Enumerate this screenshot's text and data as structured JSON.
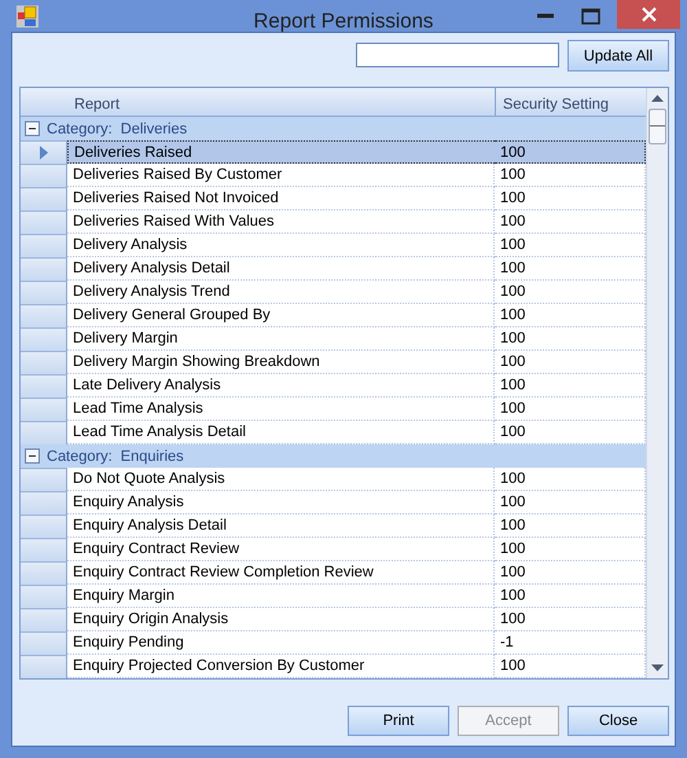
{
  "window": {
    "title": "Report Permissions"
  },
  "update_button": {
    "label": "Update All"
  },
  "table": {
    "columns": [
      "Report",
      "Security Setting"
    ],
    "groups": [
      {
        "label": "Category:  Deliveries",
        "expanded": true,
        "rows": [
          {
            "report": "Deliveries Raised",
            "setting": "100",
            "selected": true
          },
          {
            "report": "Deliveries Raised By Customer",
            "setting": "100",
            "selected": false
          },
          {
            "report": "Deliveries Raised Not Invoiced",
            "setting": "100",
            "selected": false
          },
          {
            "report": "Deliveries Raised With Values",
            "setting": "100",
            "selected": false
          },
          {
            "report": "Delivery Analysis",
            "setting": "100",
            "selected": false
          },
          {
            "report": "Delivery Analysis Detail",
            "setting": "100",
            "selected": false
          },
          {
            "report": "Delivery Analysis Trend",
            "setting": "100",
            "selected": false
          },
          {
            "report": "Delivery General Grouped By",
            "setting": "100",
            "selected": false
          },
          {
            "report": "Delivery Margin",
            "setting": "100",
            "selected": false
          },
          {
            "report": "Delivery Margin Showing Breakdown",
            "setting": "100",
            "selected": false
          },
          {
            "report": "Late Delivery Analysis",
            "setting": "100",
            "selected": false
          },
          {
            "report": "Lead Time Analysis",
            "setting": "100",
            "selected": false
          },
          {
            "report": "Lead Time Analysis Detail",
            "setting": "100",
            "selected": false
          }
        ]
      },
      {
        "label": "Category:  Enquiries",
        "expanded": true,
        "rows": [
          {
            "report": "Do Not Quote Analysis",
            "setting": "100",
            "selected": false
          },
          {
            "report": "Enquiry Analysis",
            "setting": "100",
            "selected": false
          },
          {
            "report": "Enquiry Analysis Detail",
            "setting": "100",
            "selected": false
          },
          {
            "report": "Enquiry Contract Review",
            "setting": "100",
            "selected": false
          },
          {
            "report": "Enquiry Contract Review Completion Review",
            "setting": "100",
            "selected": false
          },
          {
            "report": "Enquiry Margin",
            "setting": "100",
            "selected": false
          },
          {
            "report": "Enquiry Origin Analysis",
            "setting": "100",
            "selected": false
          },
          {
            "report": "Enquiry Pending",
            "setting": "-1",
            "selected": false
          },
          {
            "report": "Enquiry Projected Conversion By Customer",
            "setting": "100",
            "selected": false
          }
        ]
      }
    ]
  },
  "buttons": [
    {
      "label": "Print",
      "disabled": false
    },
    {
      "label": "Accept",
      "disabled": true
    },
    {
      "label": "Close",
      "disabled": false
    }
  ]
}
